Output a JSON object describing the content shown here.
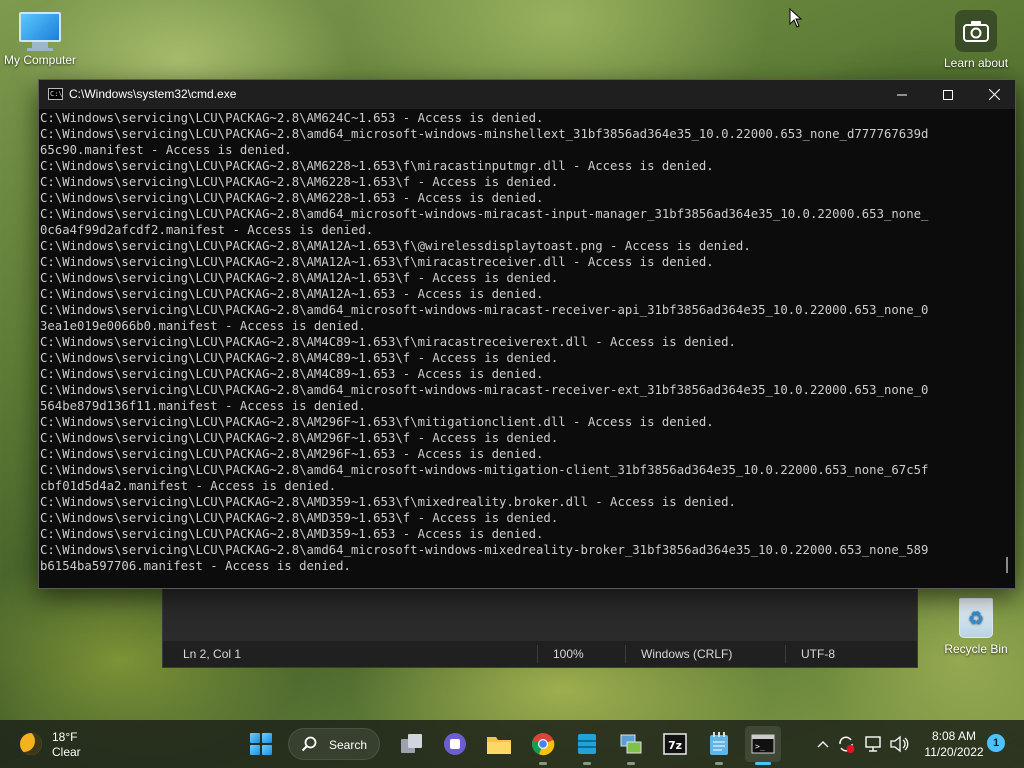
{
  "desktop": {
    "my_computer_label": "My Computer",
    "camera_label": "Learn about this picture",
    "recycle_bin_label": "Recycle Bin"
  },
  "notepad": {
    "position": "Ln 2, Col 1",
    "zoom": "100%",
    "line_ending": "Windows (CRLF)",
    "encoding": "UTF-8"
  },
  "cmd": {
    "title": "C:\\Windows\\system32\\cmd.exe",
    "lines": [
      "C:\\Windows\\servicing\\LCU\\PACKAG~2.8\\AM624C~1.653 - Access is denied.",
      "C:\\Windows\\servicing\\LCU\\PACKAG~2.8\\amd64_microsoft-windows-minshellext_31bf3856ad364e35_10.0.22000.653_none_d777767639d",
      "65c90.manifest - Access is denied.",
      "C:\\Windows\\servicing\\LCU\\PACKAG~2.8\\AM6228~1.653\\f\\miracastinputmgr.dll - Access is denied.",
      "C:\\Windows\\servicing\\LCU\\PACKAG~2.8\\AM6228~1.653\\f - Access is denied.",
      "C:\\Windows\\servicing\\LCU\\PACKAG~2.8\\AM6228~1.653 - Access is denied.",
      "C:\\Windows\\servicing\\LCU\\PACKAG~2.8\\amd64_microsoft-windows-miracast-input-manager_31bf3856ad364e35_10.0.22000.653_none_",
      "0c6a4f99d2afcdf2.manifest - Access is denied.",
      "C:\\Windows\\servicing\\LCU\\PACKAG~2.8\\AMA12A~1.653\\f\\@wirelessdisplaytoast.png - Access is denied.",
      "C:\\Windows\\servicing\\LCU\\PACKAG~2.8\\AMA12A~1.653\\f\\miracastreceiver.dll - Access is denied.",
      "C:\\Windows\\servicing\\LCU\\PACKAG~2.8\\AMA12A~1.653\\f - Access is denied.",
      "C:\\Windows\\servicing\\LCU\\PACKAG~2.8\\AMA12A~1.653 - Access is denied.",
      "C:\\Windows\\servicing\\LCU\\PACKAG~2.8\\amd64_microsoft-windows-miracast-receiver-api_31bf3856ad364e35_10.0.22000.653_none_0",
      "3ea1e019e0066b0.manifest - Access is denied.",
      "C:\\Windows\\servicing\\LCU\\PACKAG~2.8\\AM4C89~1.653\\f\\miracastreceiverext.dll - Access is denied.",
      "C:\\Windows\\servicing\\LCU\\PACKAG~2.8\\AM4C89~1.653\\f - Access is denied.",
      "C:\\Windows\\servicing\\LCU\\PACKAG~2.8\\AM4C89~1.653 - Access is denied.",
      "C:\\Windows\\servicing\\LCU\\PACKAG~2.8\\amd64_microsoft-windows-miracast-receiver-ext_31bf3856ad364e35_10.0.22000.653_none_0",
      "564be879d136f11.manifest - Access is denied.",
      "C:\\Windows\\servicing\\LCU\\PACKAG~2.8\\AM296F~1.653\\f\\mitigationclient.dll - Access is denied.",
      "C:\\Windows\\servicing\\LCU\\PACKAG~2.8\\AM296F~1.653\\f - Access is denied.",
      "C:\\Windows\\servicing\\LCU\\PACKAG~2.8\\AM296F~1.653 - Access is denied.",
      "C:\\Windows\\servicing\\LCU\\PACKAG~2.8\\amd64_microsoft-windows-mitigation-client_31bf3856ad364e35_10.0.22000.653_none_67c5f",
      "cbf01d5d4a2.manifest - Access is denied.",
      "C:\\Windows\\servicing\\LCU\\PACKAG~2.8\\AMD359~1.653\\f\\mixedreality.broker.dll - Access is denied.",
      "C:\\Windows\\servicing\\LCU\\PACKAG~2.8\\AMD359~1.653\\f - Access is denied.",
      "C:\\Windows\\servicing\\LCU\\PACKAG~2.8\\AMD359~1.653 - Access is denied.",
      "C:\\Windows\\servicing\\LCU\\PACKAG~2.8\\amd64_microsoft-windows-mixedreality-broker_31bf3856ad364e35_10.0.22000.653_none_589",
      "b6154ba597706.manifest - Access is denied."
    ]
  },
  "taskbar": {
    "weather_temp": "18°F",
    "weather_condition": "Clear",
    "search_label": "Search",
    "apps": [
      "start-icon",
      "search-icon",
      "task-view-icon",
      "teams-chat-icon",
      "file-explorer-icon",
      "chrome-icon",
      "database-icon",
      "network-tool-icon",
      "7zip-icon",
      "notepad-icon",
      "terminal-icon"
    ],
    "time": "8:08 AM",
    "date": "11/20/2022",
    "notification_count": "1"
  },
  "colors": {
    "console_bg": "#0c0c0c",
    "console_text": "#cccccc",
    "accent": "#4cc2ff"
  }
}
